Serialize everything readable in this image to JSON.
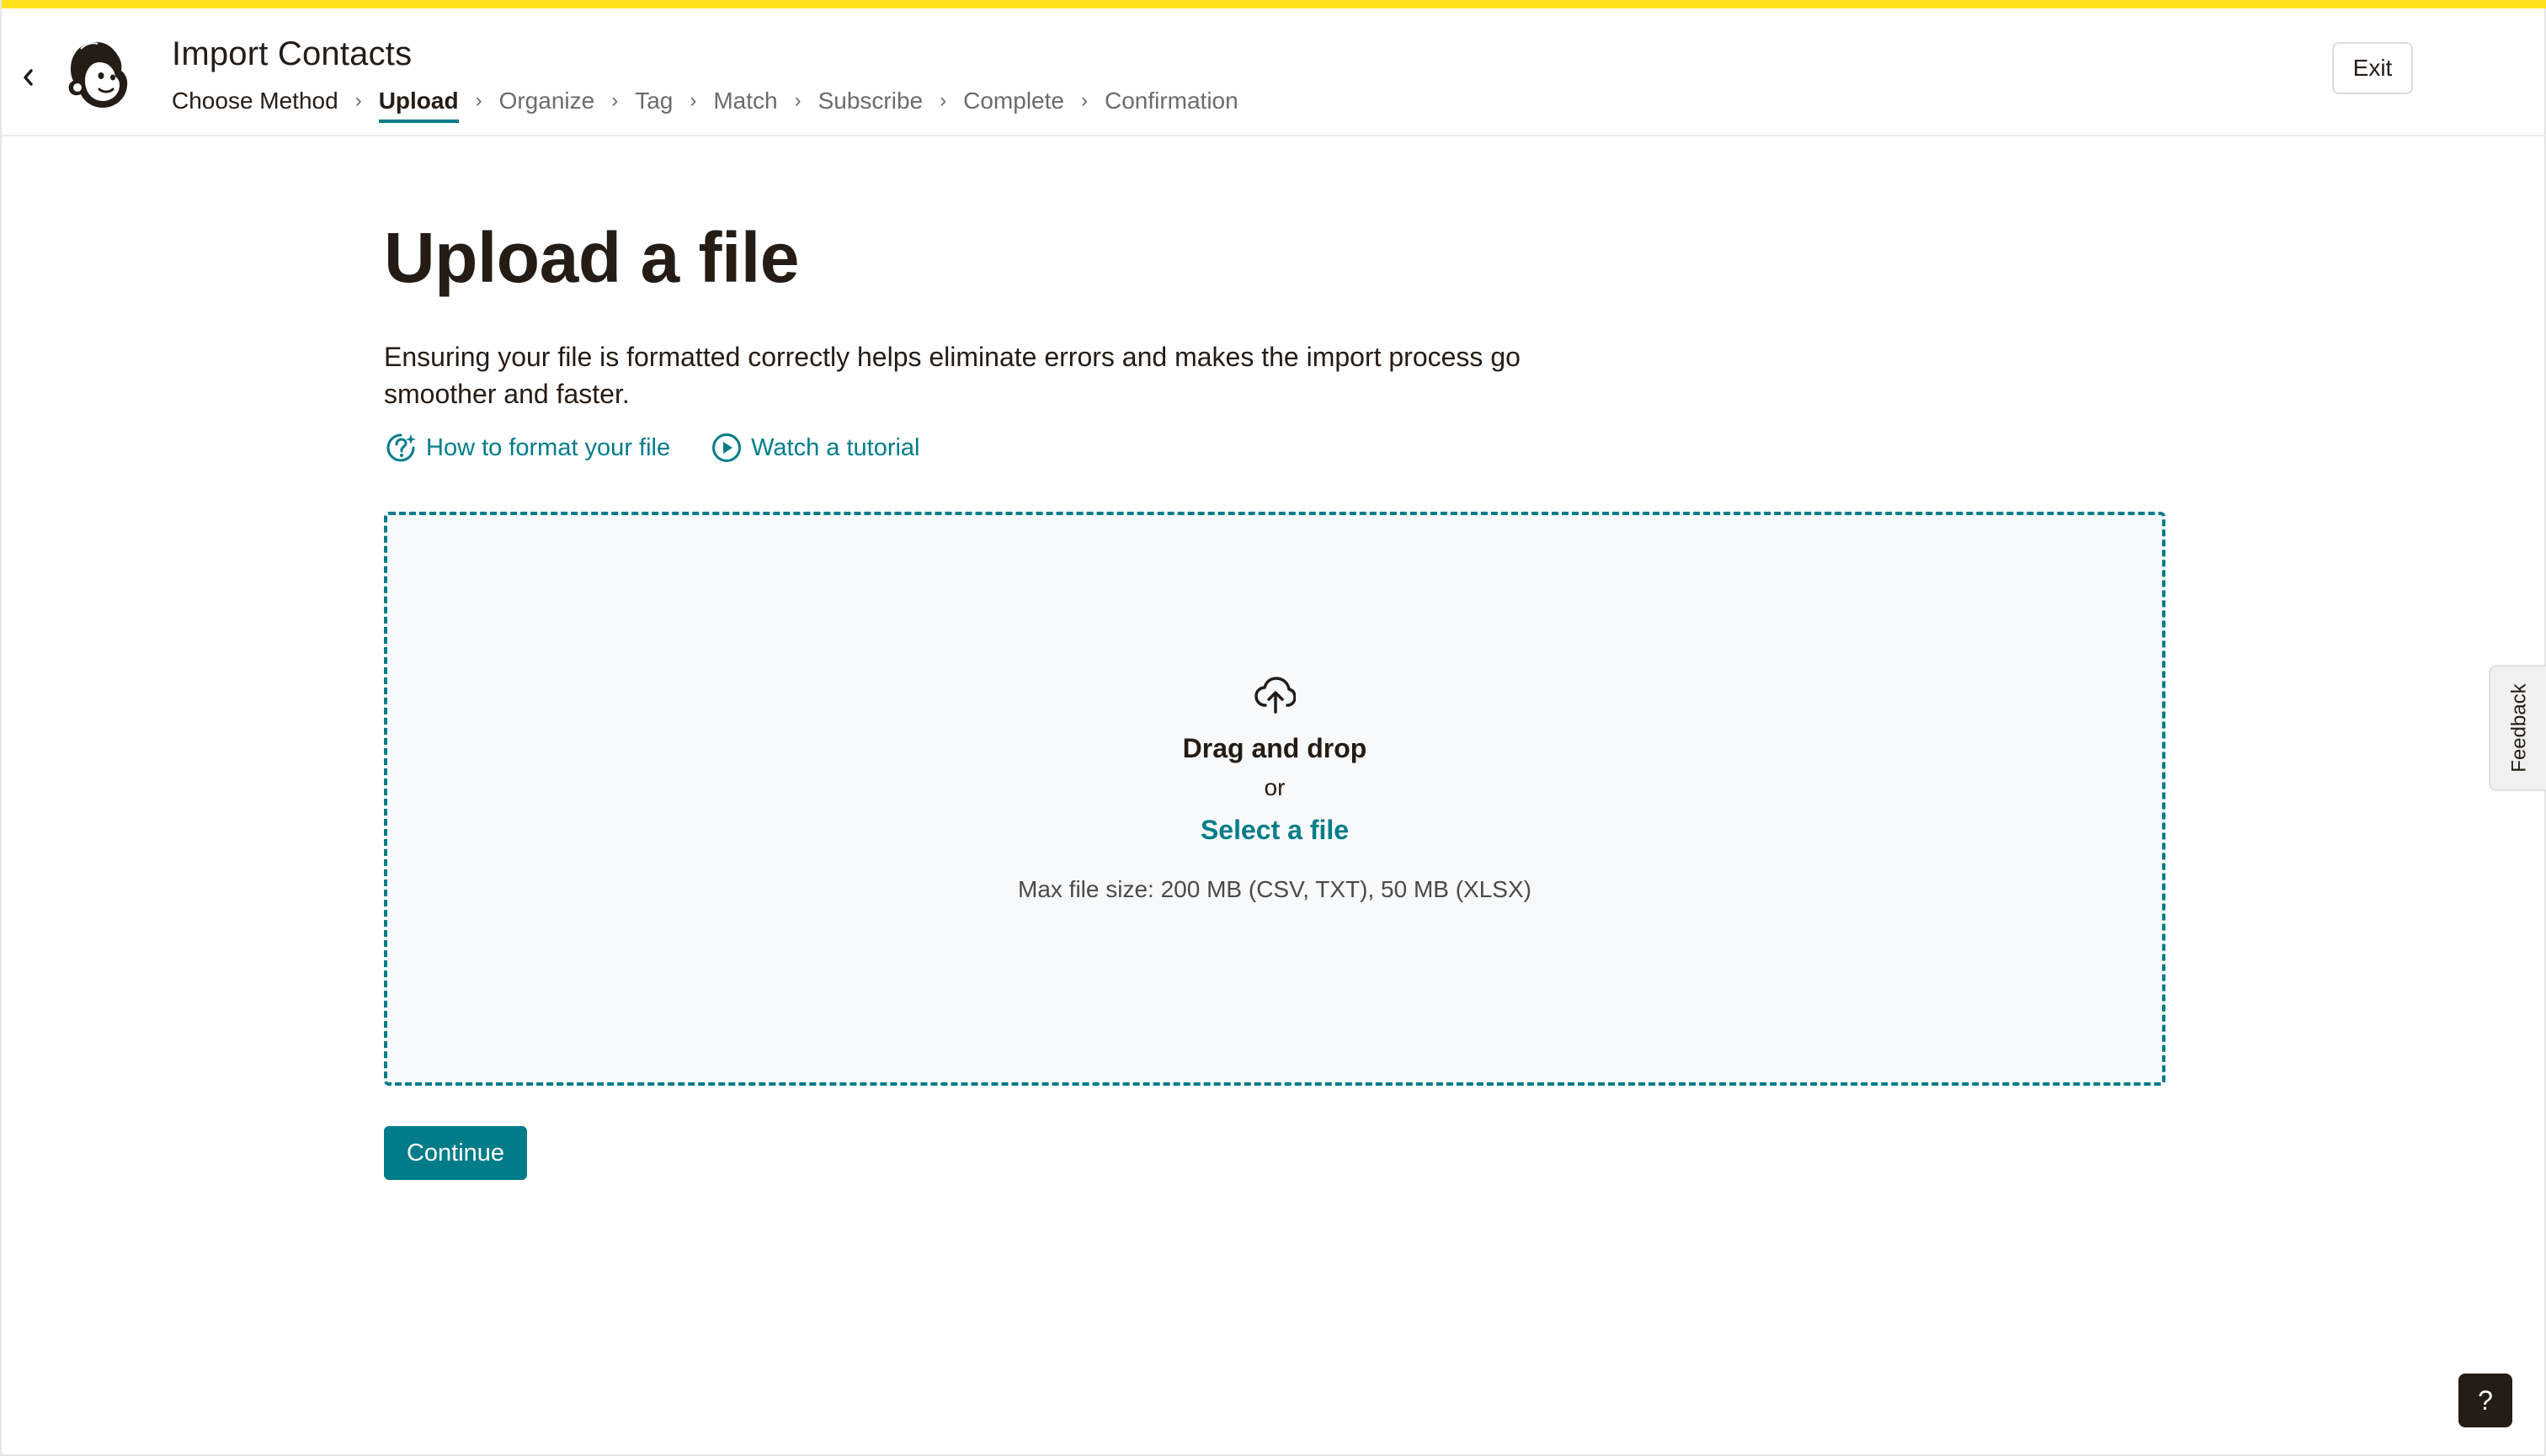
{
  "app": {
    "title": "Import Contacts",
    "accent_color": "#ffe01b",
    "brand_color": "#007c89"
  },
  "header": {
    "back_icon": "chevron-left-icon",
    "logo": "mailchimp-freddie-logo",
    "exit_label": "Exit",
    "breadcrumb": [
      {
        "label": "Choose Method",
        "state": "done"
      },
      {
        "label": "Upload",
        "state": "active"
      },
      {
        "label": "Organize",
        "state": "upcoming"
      },
      {
        "label": "Tag",
        "state": "upcoming"
      },
      {
        "label": "Match",
        "state": "upcoming"
      },
      {
        "label": "Subscribe",
        "state": "upcoming"
      },
      {
        "label": "Complete",
        "state": "upcoming"
      },
      {
        "label": "Confirmation",
        "state": "upcoming"
      }
    ],
    "separator": "›"
  },
  "main": {
    "title": "Upload a file",
    "description": "Ensuring your file is formatted correctly helps eliminate errors and makes the import process go smoother and faster.",
    "help_links": [
      {
        "label": "How to format your file",
        "icon": "help-sparkle-icon"
      },
      {
        "label": "Watch a tutorial",
        "icon": "play-circle-icon"
      }
    ],
    "dropzone": {
      "icon": "cloud-upload-icon",
      "title": "Drag and drop",
      "or_text": "or",
      "select_label": "Select a file",
      "limits": "Max file size: 200 MB (CSV, TXT), 50 MB (XLSX)"
    },
    "continue_label": "Continue"
  },
  "feedback_label": "Feedback",
  "help_fab_label": "?"
}
